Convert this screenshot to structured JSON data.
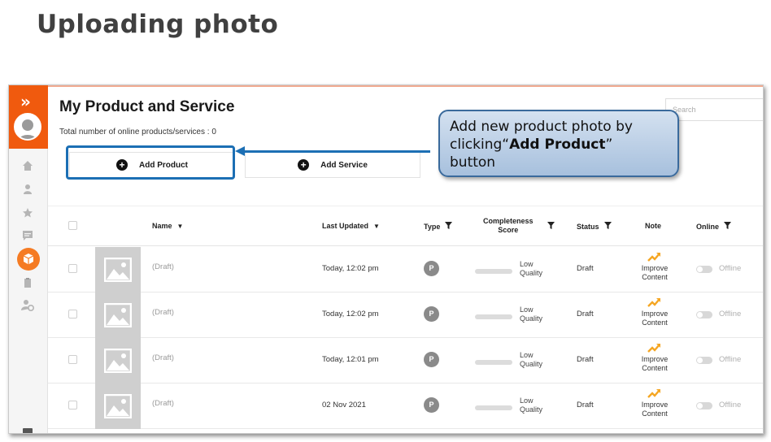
{
  "slide": {
    "title": "Uploading photo"
  },
  "page": {
    "title": "My Product and Service",
    "total_label": "Total number of online products/services : 0",
    "search_placeholder": "Search"
  },
  "buttons": {
    "add_product": "Add Product",
    "add_service": "Add Service"
  },
  "table": {
    "columns": {
      "name": "Name",
      "last_updated": "Last Updated",
      "type": "Type",
      "completeness_line1": "Completeness",
      "completeness_line2": "Score",
      "status": "Status",
      "note": "Note",
      "online": "Online"
    },
    "rows": [
      {
        "name": "(Draft)",
        "updated": "Today, 12:02 pm",
        "type": "P",
        "quality1": "Low",
        "quality2": "Quality",
        "status": "Draft",
        "note1": "Improve",
        "note2": "Content",
        "online": "Offline"
      },
      {
        "name": "(Draft)",
        "updated": "Today, 12:02 pm",
        "type": "P",
        "quality1": "Low",
        "quality2": "Quality",
        "status": "Draft",
        "note1": "Improve",
        "note2": "Content",
        "online": "Offline"
      },
      {
        "name": "(Draft)",
        "updated": "Today, 12:01 pm",
        "type": "P",
        "quality1": "Low",
        "quality2": "Quality",
        "status": "Draft",
        "note1": "Improve",
        "note2": "Content",
        "online": "Offline"
      },
      {
        "name": "(Draft)",
        "updated": "02 Nov 2021",
        "type": "P",
        "quality1": "Low",
        "quality2": "Quality",
        "status": "Draft",
        "note1": "Improve",
        "note2": "Content",
        "online": "Offline"
      }
    ]
  },
  "callout": {
    "line1": "Add new product photo by",
    "line2_prefix": "clicking“",
    "line2_bold": "Add Product",
    "line2_suffix": "”",
    "line3": "button"
  },
  "colors": {
    "brand_orange": "#f05a0e",
    "highlight_blue": "#1c6fb4",
    "improve_icon": "#f5a623"
  },
  "icons": [
    "double-chevron-right-icon",
    "home-icon",
    "user-icon",
    "star-icon",
    "message-icon",
    "box-icon",
    "clipboard-icon",
    "user-settings-icon",
    "plus-circle-icon",
    "image-placeholder-icon",
    "filter-icon",
    "trend-up-icon"
  ]
}
